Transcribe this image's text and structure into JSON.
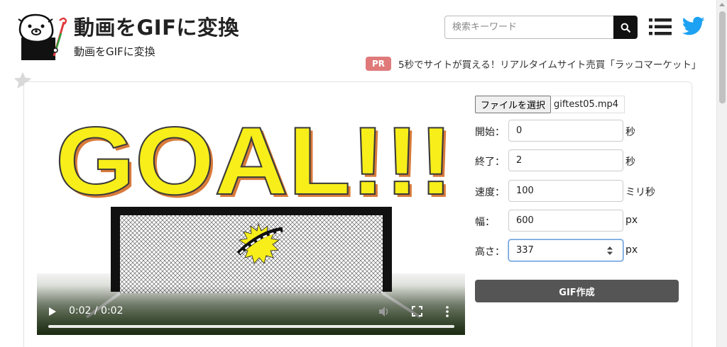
{
  "header": {
    "title": "動画をGIFに変換",
    "subtitle": "動画をGIFに変換"
  },
  "search": {
    "placeholder": "検索キーワード",
    "button_icon": "search-icon"
  },
  "nav": {
    "menu_icon": "list-menu-icon",
    "twitter_icon": "twitter-icon"
  },
  "pr": {
    "badge": "PR",
    "text": "5秒でサイトが買える！リアルタイムサイト売買「ラッコマーケット」"
  },
  "video": {
    "time": "0:02 / 0:02",
    "progress": 1.0,
    "content_text": "GOAL!!!"
  },
  "form": {
    "file_button": "ファイルを選択",
    "file_name": "giftest05.mp4",
    "fields": [
      {
        "label": "開始：",
        "value": "0",
        "unit": "秒"
      },
      {
        "label": "終了：",
        "value": "2",
        "unit": "秒"
      },
      {
        "label": "速度：",
        "value": "100",
        "unit": "ミリ秒"
      },
      {
        "label": "幅：",
        "value": "600",
        "unit": "px"
      },
      {
        "label": "高さ：",
        "value": "337",
        "unit": "px"
      }
    ],
    "submit": "GIF作成"
  },
  "colors": {
    "pr_badge": "#e07a7a",
    "twitter": "#1da1f2",
    "submit_bg": "#555555",
    "goal_text": "#f7ee1a"
  }
}
